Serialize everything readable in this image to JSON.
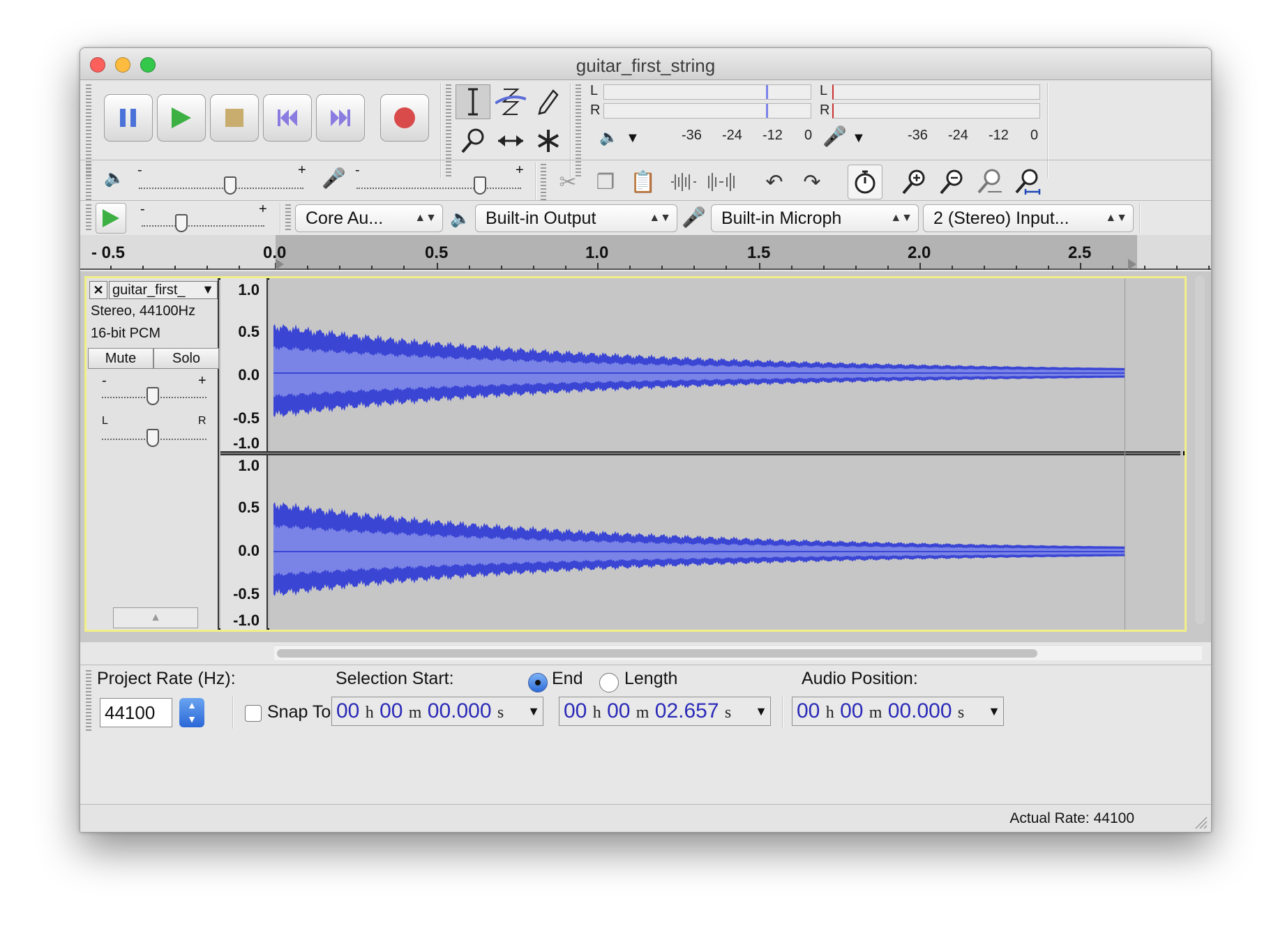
{
  "window": {
    "title": "guitar_first_string"
  },
  "meters": {
    "playback_channels": [
      "L",
      "R"
    ],
    "record_channels": [
      "L",
      "R"
    ],
    "playback_scale": [
      "-36",
      "-24",
      "-12",
      "0"
    ],
    "record_scale": [
      "-36",
      "-24",
      "-12",
      "0"
    ]
  },
  "device_toolbar": {
    "host": "Core Au...",
    "output": "Built-in Output",
    "input": "Built-in Microph",
    "channels": "2 (Stereo) Input..."
  },
  "slider_marks": {
    "minus": "-",
    "plus": "+"
  },
  "ruler": {
    "labels": [
      "- 0.5",
      "0.0",
      "0.5",
      "1.0",
      "1.5",
      "2.0",
      "2.5"
    ]
  },
  "track": {
    "name": "guitar_first_",
    "format": "Stereo, 44100Hz",
    "bit_depth": "16-bit PCM",
    "mute_label": "Mute",
    "solo_label": "Solo",
    "gain_minus": "-",
    "gain_plus": "+",
    "pan_left": "L",
    "pan_right": "R",
    "close_glyph": "✕",
    "collapse_glyph": "▲",
    "vertical_scale": [
      "1.0",
      "0.5",
      "0.0",
      "-0.5",
      "-1.0"
    ],
    "waveform_color": "#3a45d4",
    "waveform_rms_color": "#7a84e6"
  },
  "selection_toolbar": {
    "project_rate_label": "Project Rate (Hz):",
    "project_rate_value": "44100",
    "snap_to_label": "Snap To",
    "selection_start_label": "Selection Start:",
    "end_label": "End",
    "length_label": "Length",
    "audio_position_label": "Audio Position:",
    "selection_start": {
      "h": "00",
      "m": "00",
      "s": "00.000"
    },
    "selection_end": {
      "h": "00",
      "m": "00",
      "s": "02.657"
    },
    "audio_position": {
      "h": "00",
      "m": "00",
      "s": "00.000"
    },
    "unit_h": "h",
    "unit_m": "m",
    "unit_s": "s"
  },
  "status": {
    "actual_rate": "Actual Rate: 44100"
  },
  "colors": {
    "close": "#ff5f57",
    "minimize": "#febc2e",
    "zoom": "#28c840",
    "play": "#3cb043",
    "pause": "#4a72d8",
    "record": "#d23b3b",
    "skip": "#8a7be0",
    "highlight_border": "#f2ef87"
  }
}
